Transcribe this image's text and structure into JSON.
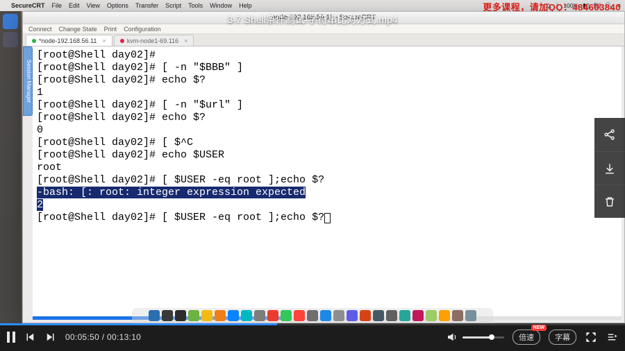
{
  "video": {
    "overlay_title": "3-7 Shell条件测试-字符串比对方式.mp4",
    "current_time": "00:05:50",
    "duration": "00:13:10",
    "speed_label": "倍速",
    "speed_badge": "NEW",
    "subtitle_label": "字幕"
  },
  "mac_menubar": {
    "app": "SecureCRT",
    "menus": [
      "File",
      "Edit",
      "View",
      "Options",
      "Transfer",
      "Script",
      "Tools",
      "Window",
      "Help"
    ],
    "right": {
      "battery": "100%",
      "flag": "🇺🇸"
    }
  },
  "watermark": "更多课程，请加QQ：484603840",
  "crt": {
    "title": "node-192.168.56.11 - SecureCRT",
    "toolbar": [
      "Connect",
      "Change State",
      "Print",
      "Configuration"
    ],
    "tabs": [
      {
        "label": "*node-192.168.56.11",
        "active": true
      },
      {
        "label": "kvm-node1-69.116",
        "active": false
      }
    ],
    "session_manager_label": "Session Manager"
  },
  "terminal": {
    "lines": [
      {
        "prompt": "[root@Shell day02]# "
      },
      {
        "prompt": "[root@Shell day02]# ",
        "cmd": "[ -n \"$BBB\" ]"
      },
      {
        "prompt": "[root@Shell day02]# ",
        "cmd": "echo $?"
      },
      {
        "out": "1"
      },
      {
        "prompt": "[root@Shell day02]# ",
        "cmd": "[ -n \"$url\" ]"
      },
      {
        "prompt": "[root@Shell day02]# ",
        "cmd": "echo $?"
      },
      {
        "out": "0"
      },
      {
        "prompt": "[root@Shell day02]# ",
        "cmd": "[ $^C"
      },
      {
        "prompt": "[root@Shell day02]# ",
        "cmd": "echo $USER"
      },
      {
        "out": "root"
      },
      {
        "prompt": "[root@Shell day02]# ",
        "cmd": "[ $USER -eq root ];echo $?"
      },
      {
        "hl": "-bash: [: root: integer expression expected"
      },
      {
        "hl": "2"
      },
      {
        "prompt": "[root@Shell day02]# ",
        "cmd": "[ $USER -eq root ];echo $?",
        "cursor": true
      }
    ]
  },
  "dock_colors": [
    "#2b6fb3",
    "#3a3a3a",
    "#2d2d2d",
    "#6db33f",
    "#f2bb13",
    "#f07f1a",
    "#0a84ff",
    "#00b7c3",
    "#7d7d7d",
    "#eb3b2e",
    "#34c759",
    "#ff453a",
    "#6e6e6e",
    "#1e88e5",
    "#8e8e8e",
    "#5e5ce6",
    "#d84315",
    "#455a64",
    "#616161",
    "#26a69a",
    "#c2185b",
    "#9ccc65",
    "#ffa000",
    "#8d6e63",
    "#78909c"
  ]
}
